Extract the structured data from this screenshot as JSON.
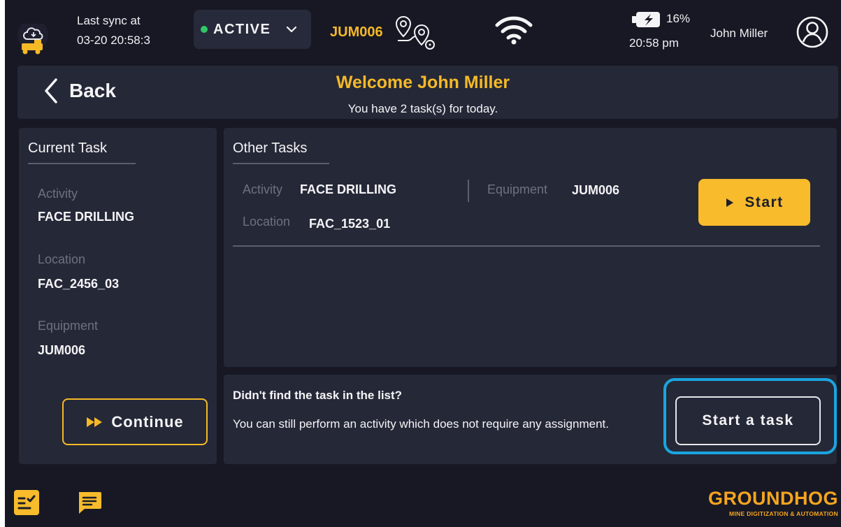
{
  "header": {
    "sync_line1": "Last sync at",
    "sync_line2": "03-20 20:58:3",
    "status": "ACTIVE",
    "equipment": "JUM006",
    "battery": "16%",
    "time": "20:58 pm",
    "user": "John Miller"
  },
  "welcome": {
    "back": "Back",
    "title": "Welcome John Miller",
    "subtitle": "You have 2 task(s) for today."
  },
  "current_task": {
    "title": "Current Task",
    "activity_label": "Activity",
    "activity": "FACE DRILLING",
    "location_label": "Location",
    "location": "FAC_2456_03",
    "equipment_label": "Equipment",
    "equipment": "JUM006",
    "continue": "Continue"
  },
  "other_tasks": {
    "title": "Other Tasks",
    "items": [
      {
        "activity_label": "Activity",
        "activity": "FACE DRILLING",
        "equipment_label": "Equipment",
        "equipment": "JUM006",
        "location_label": "Location",
        "location": "FAC_1523_01",
        "start": "Start"
      }
    ]
  },
  "find_task": {
    "title": "Didn't find the task in the list?",
    "body": "You can still perform an activity which does not require any assignment.",
    "button": "Start a task"
  },
  "brand": {
    "name": "GROUNDHOG",
    "tagline": "MINE DIGITIZATION & AUTOMATION"
  },
  "colors": {
    "background": "#171824",
    "panel": "#252837",
    "accent": "#f5b928",
    "active": "#31c76a",
    "highlight": "#1aa5e0"
  }
}
